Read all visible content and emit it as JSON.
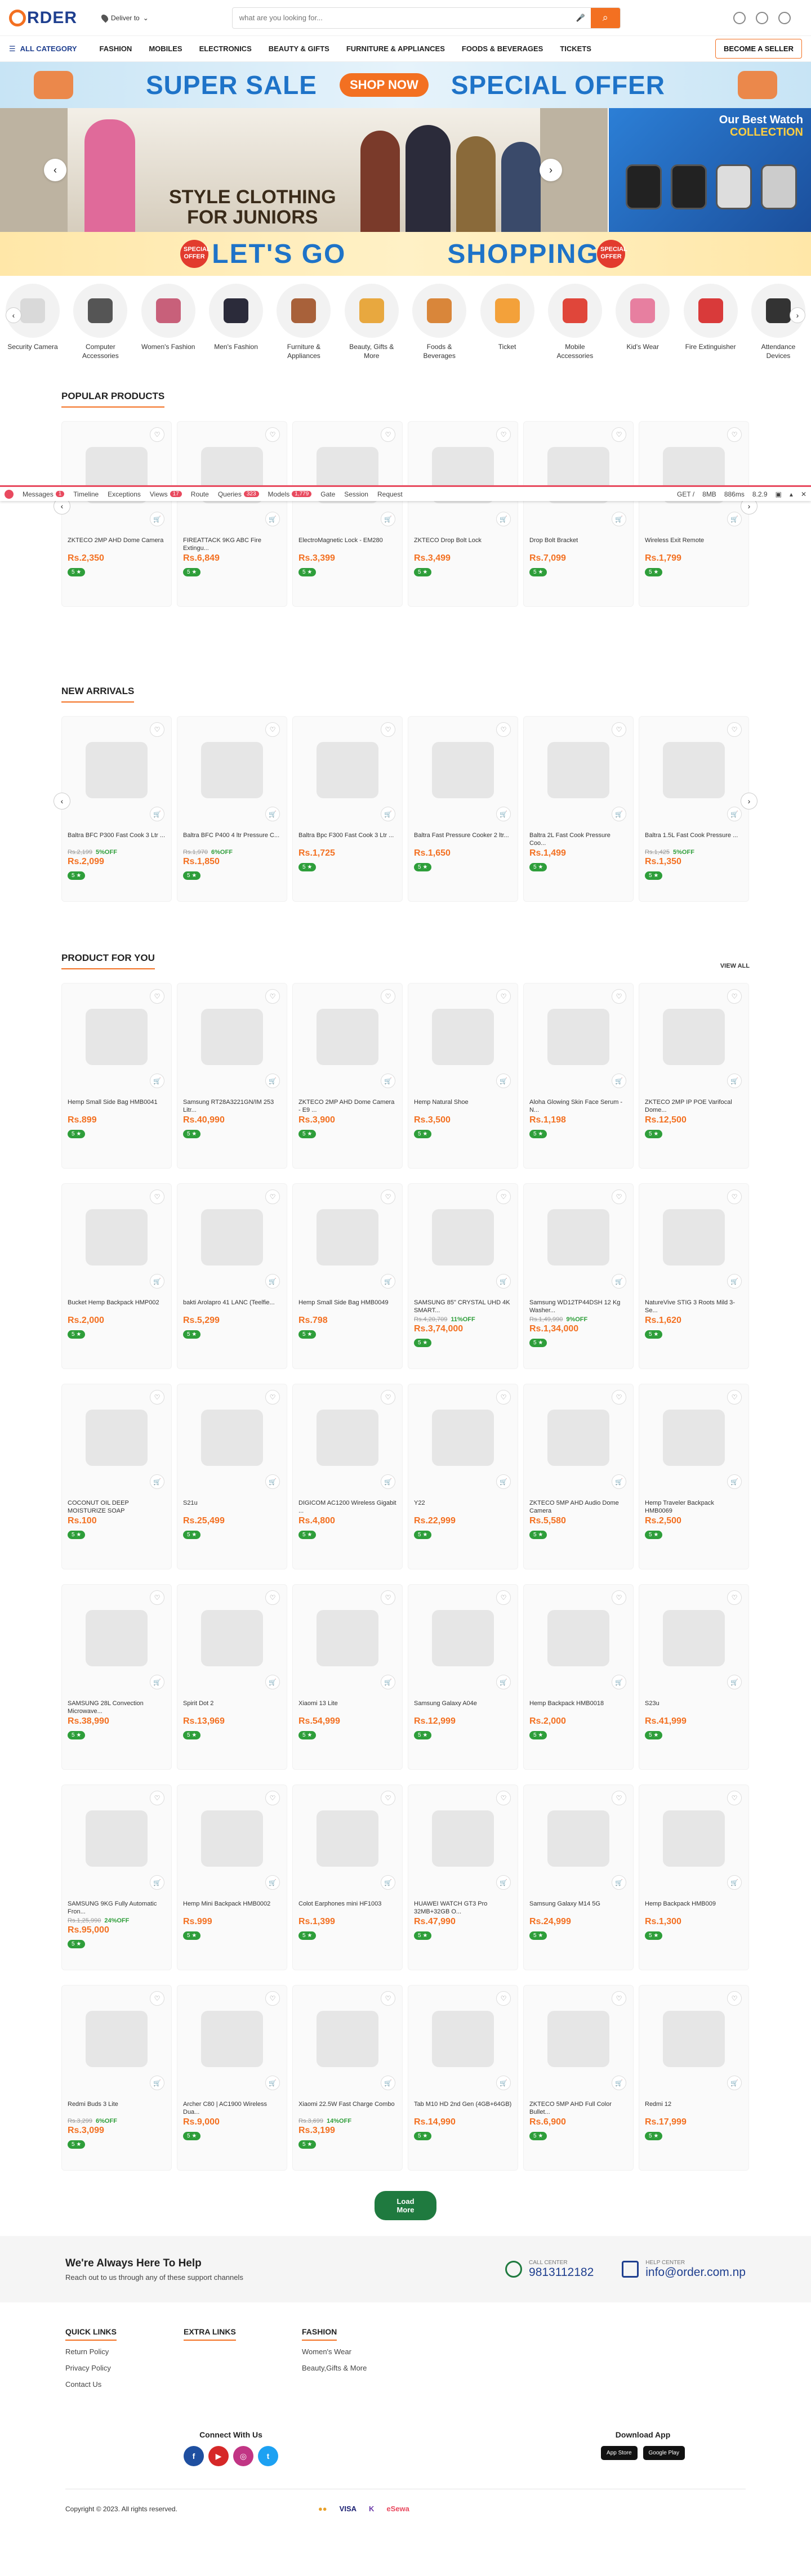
{
  "header": {
    "logo_letter": "O",
    "logo_text": "RDER",
    "deliver": "Deliver to",
    "search_placeholder": "what are you looking for..."
  },
  "nav": {
    "all_category": "ALL CATEGORY",
    "links": [
      "FASHION",
      "MOBILES",
      "ELECTRONICS",
      "BEAUTY & GIFTS",
      "FURNITURE & APPLIANCES",
      "FOODS & BEVERAGES",
      "TICKETS"
    ],
    "seller": "BECOME A SELLER"
  },
  "banner_sale": {
    "left": "SUPER SALE",
    "button": "SHOP NOW",
    "right": "SPECIAL OFFER"
  },
  "hero": {
    "line1": "STYLE CLOTHING",
    "line2": "FOR JUNIORS"
  },
  "watch_banner": {
    "line1": "Our Best Watch",
    "line2": "COLLECTION"
  },
  "banner_go": {
    "left": "LET'S GO",
    "right": "SHOPPING",
    "badge": "SPECIAL OFFER"
  },
  "categories": [
    "Security Camera",
    "Computer Accessories",
    "Women's Fashion",
    "Men's Fashion",
    "Furniture & Appliances",
    "Beauty, Gifts & More",
    "Foods & Beverages",
    "Ticket",
    "Mobile Accessories",
    "Kid's Wear",
    "Fire Extinguisher",
    "Attendance Devices"
  ],
  "category_colors": [
    "#d9d9d9",
    "#555555",
    "#c8607a",
    "#2b2b3a",
    "#a8613a",
    "#e8a83f",
    "#d9863a",
    "#f3a13a",
    "#e0463a",
    "#e77fa0",
    "#d93a3a",
    "#333333"
  ],
  "debugbar": {
    "tabs": [
      {
        "label": "Messages",
        "count": "1"
      },
      {
        "label": "Timeline"
      },
      {
        "label": "Exceptions"
      },
      {
        "label": "Views",
        "count": "17"
      },
      {
        "label": "Route"
      },
      {
        "label": "Queries",
        "count": "323"
      },
      {
        "label": "Models",
        "count": "1,779"
      },
      {
        "label": "Gate"
      },
      {
        "label": "Session"
      },
      {
        "label": "Request"
      }
    ],
    "method": "GET /",
    "memory": "8MB",
    "time": "886ms",
    "php": "8.2.9"
  },
  "popular": {
    "title": "POPULAR PRODUCTS",
    "items": [
      {
        "name": "ZKTECO 2MP AHD Dome Camera",
        "price": "Rs.2,350",
        "rating": "5 ★"
      },
      {
        "name": "FIREATTACK 9KG ABC Fire Extingu...",
        "price": "Rs.6,849",
        "rating": "5 ★"
      },
      {
        "name": "ElectroMagnetic Lock - EM280",
        "price": "Rs.3,399",
        "rating": "5 ★"
      },
      {
        "name": "ZKTECO Drop Bolt Lock",
        "price": "Rs.3,499",
        "rating": "5 ★"
      },
      {
        "name": "Drop Bolt Bracket",
        "price": "Rs.7,099",
        "rating": "5 ★"
      },
      {
        "name": "Wireless Exit Remote",
        "price": "Rs.1,799",
        "rating": "5 ★"
      }
    ]
  },
  "arrivals": {
    "title": "NEW ARRIVALS",
    "items": [
      {
        "name": "Baltra BFC P300 Fast Cook 3 Ltr ...",
        "old": "Rs.2,199",
        "off": "5%OFF",
        "price": "Rs.2,099",
        "rating": "5 ★"
      },
      {
        "name": "Baltra BFC P400 4 ltr Pressure C...",
        "old": "Rs.1,970",
        "off": "6%OFF",
        "price": "Rs.1,850",
        "rating": "5 ★"
      },
      {
        "name": "Baltra Bpc F300 Fast Cook 3 Ltr ...",
        "price": "Rs.1,725",
        "rating": "5 ★"
      },
      {
        "name": "Baltra Fast Pressure Cooker 2 ltr...",
        "price": "Rs.1,650",
        "rating": "5 ★"
      },
      {
        "name": "Baltra 2L Fast Cook Pressure Coo...",
        "price": "Rs.1,499",
        "rating": "5 ★"
      },
      {
        "name": "Baltra 1.5L Fast Cook Pressure ...",
        "old": "Rs.1,425",
        "off": "5%OFF",
        "price": "Rs.1,350",
        "rating": "5 ★"
      }
    ]
  },
  "foryou": {
    "title": "PRODUCT FOR YOU",
    "viewall": "VIEW ALL",
    "items": [
      {
        "name": "Hemp Small Side Bag HMB0041",
        "price": "Rs.899",
        "rating": "5 ★"
      },
      {
        "name": "Samsung RT28A3221GN/IM 253 Litr...",
        "price": "Rs.40,990",
        "rating": "5 ★"
      },
      {
        "name": "ZKTECO 2MP AHD Dome Camera - E9 ...",
        "price": "Rs.3,900",
        "rating": "5 ★"
      },
      {
        "name": "Hemp Natural Shoe",
        "price": "Rs.3,500",
        "rating": "5 ★"
      },
      {
        "name": "Aloha Glowing Skin Face Serum -N...",
        "price": "Rs.1,198",
        "rating": "5 ★"
      },
      {
        "name": "ZKTECO 2MP IP POE Varifocal Dome...",
        "price": "Rs.12,500",
        "rating": "5 ★"
      },
      {
        "name": "Bucket Hemp Backpack HMP002",
        "price": "Rs.2,000",
        "rating": "5 ★"
      },
      {
        "name": "bakti Arolapro 41 LANC (Teelfie...",
        "price": "Rs.5,299",
        "rating": "5 ★"
      },
      {
        "name": "Hemp Small Side Bag HMB0049",
        "price": "Rs.798",
        "rating": "5 ★"
      },
      {
        "name": "SAMSUNG 85\" CRYSTAL UHD 4K SMART...",
        "old": "Rs.4,20,709",
        "off": "11%OFF",
        "price": "Rs.3,74,000",
        "rating": "5 ★"
      },
      {
        "name": "Samsung WD12TP44DSH 12 Kg Washer...",
        "old": "Rs.1,49,990",
        "off": "9%OFF",
        "price": "Rs.1,34,000",
        "rating": "5 ★"
      },
      {
        "name": "NatureVive STIG 3 Roots Mild 3-Se...",
        "price": "Rs.1,620",
        "rating": "5 ★"
      },
      {
        "name": "COCONUT OIL DEEP MOISTURIZE SOAP",
        "price": "Rs.100",
        "rating": "5 ★"
      },
      {
        "name": "S21u",
        "price": "Rs.25,499",
        "rating": "5 ★"
      },
      {
        "name": "DIGICOM AC1200 Wireless Gigabit ...",
        "price": "Rs.4,800",
        "rating": "5 ★"
      },
      {
        "name": "Y22",
        "price": "Rs.22,999",
        "rating": "5 ★"
      },
      {
        "name": "ZKTECO 5MP AHD Audio Dome Camera",
        "price": "Rs.5,580",
        "rating": "5 ★"
      },
      {
        "name": "Hemp Traveler Backpack HMB0069",
        "price": "Rs.2,500",
        "rating": "5 ★"
      },
      {
        "name": "SAMSUNG 28L Convection Microwave...",
        "price": "Rs.38,990",
        "rating": "5 ★"
      },
      {
        "name": "Spirit Dot 2",
        "price": "Rs.13,969",
        "rating": "5 ★"
      },
      {
        "name": "Xiaomi 13 Lite",
        "price": "Rs.54,999",
        "rating": "5 ★"
      },
      {
        "name": "Samsung Galaxy A04e",
        "price": "Rs.12,999",
        "rating": "5 ★"
      },
      {
        "name": "Hemp Backpack HMB0018",
        "price": "Rs.2,000",
        "rating": "5 ★"
      },
      {
        "name": "S23u",
        "price": "Rs.41,999",
        "rating": "5 ★"
      },
      {
        "name": "SAMSUNG 9KG Fully Automatic Fron...",
        "old": "Rs.1,25,990",
        "off": "24%OFF",
        "price": "Rs.95,000",
        "rating": "5 ★"
      },
      {
        "name": "Hemp Mini Backpack HMB0002",
        "price": "Rs.999",
        "rating": "5 ★"
      },
      {
        "name": "Colot Earphones mini HF1003",
        "price": "Rs.1,399",
        "rating": "5 ★"
      },
      {
        "name": "HUAWEI WATCH GT3 Pro 32MB+32GB O...",
        "price": "Rs.47,990",
        "rating": "5 ★"
      },
      {
        "name": "Samsung Galaxy M14 5G",
        "price": "Rs.24,999",
        "rating": "5 ★"
      },
      {
        "name": "Hemp Backpack HMB009",
        "price": "Rs.1,300",
        "rating": "5 ★"
      },
      {
        "name": "Redmi Buds 3 Lite",
        "old": "Rs.3,299",
        "off": "6%OFF",
        "price": "Rs.3,099",
        "rating": "5 ★"
      },
      {
        "name": "Archer C80 | AC1900 Wireless Dua...",
        "price": "Rs.9,000",
        "rating": "5 ★"
      },
      {
        "name": "Xiaomi 22.5W Fast Charge Combo",
        "old": "Rs.3,699",
        "off": "14%OFF",
        "price": "Rs.3,199",
        "rating": "5 ★"
      },
      {
        "name": "Tab M10 HD 2nd Gen (4GB+64GB)",
        "price": "Rs.14,990",
        "rating": "5 ★"
      },
      {
        "name": "ZKTECO 5MP AHD Full Color Bullet...",
        "price": "Rs.6,900",
        "rating": "5 ★"
      },
      {
        "name": "Redmi 12",
        "price": "Rs.17,999",
        "rating": "5 ★"
      }
    ]
  },
  "loadmore": "Load More",
  "help": {
    "title": "We're Always Here To Help",
    "sub": "Reach out to us through any of these support channels",
    "call_label": "CALL CENTER",
    "call": "9813112182",
    "mail_label": "HELP CENTER",
    "mail": "info@order.com.np"
  },
  "footer": {
    "cols": [
      {
        "title": "QUICK LINKS",
        "links": [
          "Return Policy",
          "Privacy Policy",
          "Contact Us"
        ]
      },
      {
        "title": "EXTRA LINKS",
        "links": []
      },
      {
        "title": "FASHION",
        "links": [
          "Women's Wear",
          "Beauty,Gifts & More"
        ]
      }
    ],
    "connect": "Connect With Us",
    "social": [
      "f",
      "▶",
      "◎",
      "t"
    ],
    "download": "Download App",
    "stores": [
      "App Store",
      "Google Play"
    ],
    "copyright": "Copyright © 2023. All rights reserved.",
    "pays": [
      "●●",
      "VISA",
      "K",
      "eSewa"
    ]
  },
  "colors": {
    "accent": "#f37021",
    "brand": "#1f3f8f",
    "green": "#2e9e3a"
  }
}
